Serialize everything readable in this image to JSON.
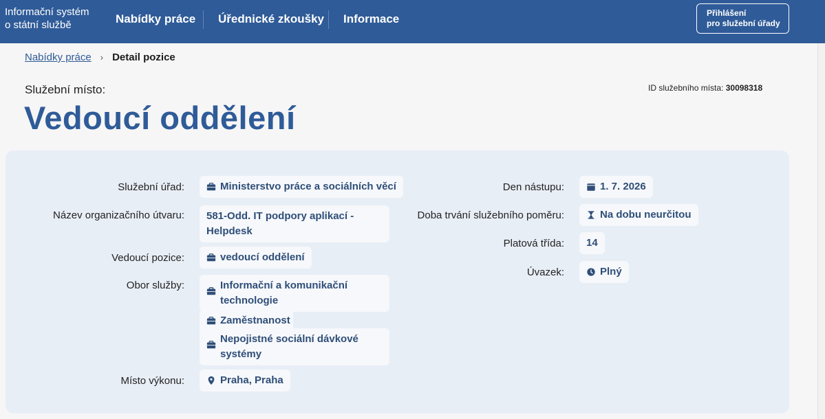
{
  "header": {
    "brand_line1": "Informační systém",
    "brand_line2": "o státní službě",
    "nav": [
      {
        "label": "Nabídky práce"
      },
      {
        "label": "Úřednické zkoušky"
      },
      {
        "label": "Informace"
      }
    ],
    "login_line1": "Přihlášení",
    "login_line2": "pro služební úřady"
  },
  "breadcrumb": {
    "parent": "Nabídky práce",
    "current": "Detail pozice"
  },
  "page": {
    "subtitle": "Služební místo:",
    "title": "Vedoucí oddělení",
    "id_label": "ID služebního místa:",
    "id_value": "30098318"
  },
  "details_left": {
    "office_label": "Služební úřad:",
    "office_value": "Ministerstvo práce a sociálních věcí",
    "unit_label": "Název organizačního útvaru:",
    "unit_value_line1": "581-Odd. IT podpory aplikací -",
    "unit_value_line2": "Helpdesk",
    "lead_label": "Vedoucí pozice:",
    "lead_value": "vedoucí oddělení",
    "field_label": "Obor služby:",
    "field_1_line1": "Informační a komunikační",
    "field_1_line2": "technologie",
    "field_2": "Zaměstnanost",
    "field_3_line1": "Nepojistné sociální dávkové",
    "field_3_line2": "systémy",
    "place_label": "Místo výkonu:",
    "place_value": "Praha, Praha"
  },
  "details_right": {
    "start_label": "Den nástupu:",
    "start_value": "1. 7. 2026",
    "duration_label": "Doba trvání služebního poměru:",
    "duration_value": "Na dobu neurčitou",
    "class_label": "Platová třída:",
    "class_value": "14",
    "workload_label": "Úvazek:",
    "workload_value": "Plný"
  },
  "icons": {
    "briefcase": "briefcase-icon",
    "calendar": "calendar-icon",
    "hourglass": "hourglass-icon",
    "clock": "clock-icon",
    "pin": "map-pin-icon",
    "chevron": "chevron-right-icon"
  },
  "colors": {
    "brand_blue": "#2f5b98",
    "chip_text": "#2f4e78",
    "card_bg": "#e8eef6"
  }
}
